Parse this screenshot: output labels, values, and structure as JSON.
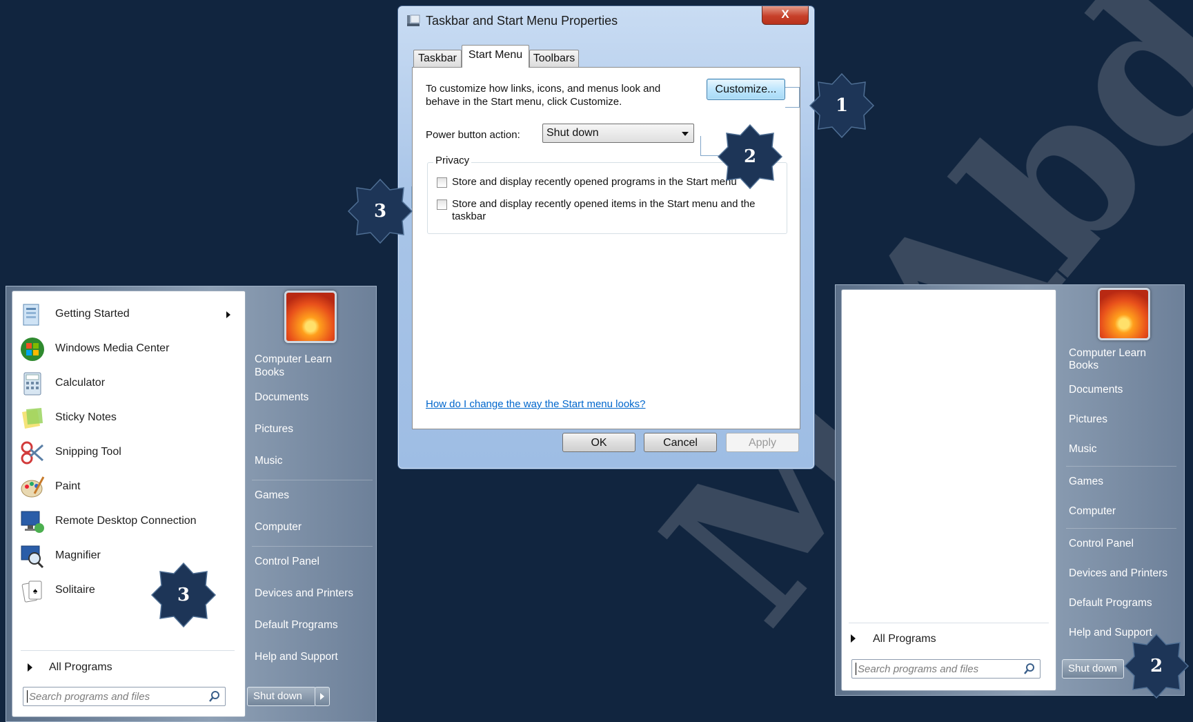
{
  "watermark": "M.Abdel-elelah",
  "dialog": {
    "title": "Taskbar and Start Menu Properties",
    "close_glyph": "X",
    "tabs": [
      "Taskbar",
      "Start Menu",
      "Toolbars"
    ],
    "active_tab": "Start Menu",
    "description": "To customize how links, icons, and menus look and behave in the Start menu, click Customize.",
    "customize_label": "Customize...",
    "power_label": "Power button action:",
    "power_value": "Shut down",
    "privacy_title": "Privacy",
    "privacy_items": [
      {
        "label": "Store and display recently opened programs in the Start menu",
        "checked": false
      },
      {
        "label": "Store and display recently opened items in the Start menu and the taskbar",
        "checked": false
      }
    ],
    "help_link": "How do I change the way the Start menu looks?",
    "ok_label": "OK",
    "cancel_label": "Cancel",
    "apply_label": "Apply"
  },
  "start_menu_left": {
    "programs": [
      {
        "label": "Getting Started",
        "icon": "getting-started-icon",
        "has_submenu": true
      },
      {
        "label": "Windows Media Center",
        "icon": "media-center-icon"
      },
      {
        "label": "Calculator",
        "icon": "calculator-icon"
      },
      {
        "label": "Sticky Notes",
        "icon": "sticky-notes-icon"
      },
      {
        "label": "Snipping Tool",
        "icon": "snipping-tool-icon"
      },
      {
        "label": "Paint",
        "icon": "paint-icon"
      },
      {
        "label": "Remote Desktop Connection",
        "icon": "remote-desktop-icon"
      },
      {
        "label": "Magnifier",
        "icon": "magnifier-icon"
      },
      {
        "label": "Solitaire",
        "icon": "solitaire-icon"
      }
    ],
    "all_programs": "All Programs",
    "search_placeholder": "Search programs and files",
    "right_items": [
      "Computer Learn Books",
      "Documents",
      "Pictures",
      "Music",
      "Games",
      "Computer",
      "Control Panel",
      "Devices and Printers",
      "Default Programs",
      "Help and Support"
    ],
    "shutdown_label": "Shut down"
  },
  "start_menu_right": {
    "all_programs": "All Programs",
    "search_placeholder": "Search programs and files",
    "right_items": [
      "Computer Learn Books",
      "Documents",
      "Pictures",
      "Music",
      "Games",
      "Computer",
      "Control Panel",
      "Devices and Printers",
      "Default Programs",
      "Help and Support"
    ],
    "shutdown_label": "Shut down"
  },
  "callouts": [
    "1",
    "2",
    "3",
    "3",
    "2"
  ],
  "colors": {
    "background": "#11253f",
    "callout_star": "#1d3557",
    "link": "#0066cc"
  }
}
